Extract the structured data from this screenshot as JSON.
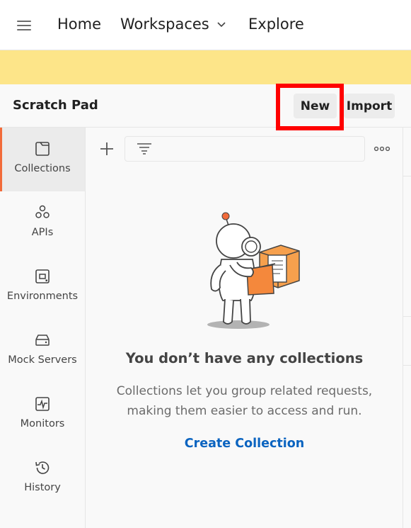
{
  "nav": {
    "home": "Home",
    "workspaces": "Workspaces",
    "explore": "Explore"
  },
  "header": {
    "title": "Scratch Pad",
    "new_label": "New",
    "import_label": "Import"
  },
  "sidebar": {
    "items": [
      {
        "label": "Collections",
        "icon": "collections-icon",
        "active": true
      },
      {
        "label": "APIs",
        "icon": "apis-icon"
      },
      {
        "label": "Environments",
        "icon": "environments-icon"
      },
      {
        "label": "Mock Servers",
        "icon": "mock-servers-icon"
      },
      {
        "label": "Monitors",
        "icon": "monitors-icon"
      },
      {
        "label": "History",
        "icon": "history-icon"
      }
    ]
  },
  "empty_state": {
    "title": "You don’t have any collections",
    "desc_line1": "Collections let you group related requests,",
    "desc_line2": "making them easier to access and run.",
    "cta": "Create Collection"
  },
  "colors": {
    "banner": "#fde589",
    "accent": "#f26b3a",
    "link": "#0b64c0",
    "highlight_box": "#ff0000"
  }
}
